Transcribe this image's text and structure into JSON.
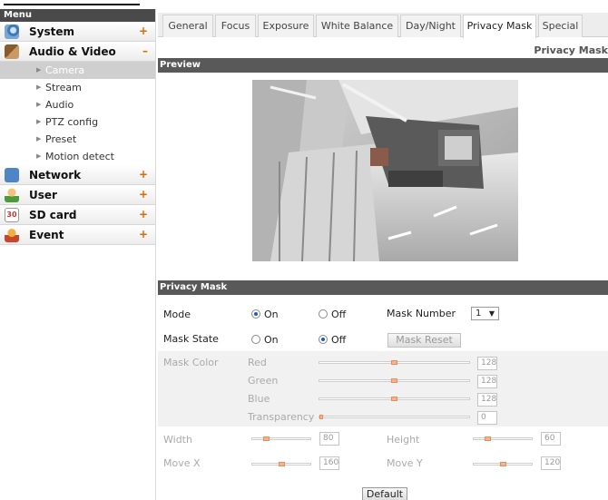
{
  "sidebar": {
    "title": "Menu",
    "groups": [
      {
        "label": "System",
        "sign": "+"
      },
      {
        "label": "Audio & Video",
        "sign": "–"
      },
      {
        "label": "Network",
        "sign": "+"
      },
      {
        "label": "User",
        "sign": "+"
      },
      {
        "label": "SD card",
        "sign": "+"
      },
      {
        "label": "Event",
        "sign": "+"
      }
    ],
    "subitems": [
      "Camera",
      "Stream",
      "Audio",
      "PTZ config",
      "Preset",
      "Motion detect"
    ],
    "active_subitem": "Camera"
  },
  "tabs": [
    "General",
    "Focus",
    "Exposure",
    "White Balance",
    "Day/Night",
    "Privacy Mask",
    "Special"
  ],
  "active_tab": "Privacy Mask",
  "page_title": "Privacy Mask",
  "preview": {
    "section_title": "Preview"
  },
  "privacy_mask": {
    "section_title": "Privacy Mask",
    "mode": {
      "label": "Mode",
      "on": "On",
      "off": "Off",
      "selected": "On"
    },
    "mask_number": {
      "label": "Mask Number",
      "value": "1"
    },
    "mask_state": {
      "label": "Mask State",
      "on": "On",
      "off": "Off",
      "selected": "Off"
    },
    "mask_reset_label": "Mask Reset",
    "mask_color": {
      "label": "Mask Color",
      "channels": [
        {
          "label": "Red",
          "value": "128"
        },
        {
          "label": "Green",
          "value": "128"
        },
        {
          "label": "Blue",
          "value": "128"
        },
        {
          "label": "Transparency",
          "value": "0"
        }
      ]
    },
    "width": {
      "label": "Width",
      "value": "80"
    },
    "height": {
      "label": "Height",
      "value": "60"
    },
    "move_x": {
      "label": "Move X",
      "value": "160"
    },
    "move_y": {
      "label": "Move Y",
      "value": "120"
    },
    "default_label": "Default"
  },
  "colors": {
    "accent_orange": "#e06a00",
    "section_bar": "#595959",
    "slider_thumb": "#f4b38c"
  }
}
